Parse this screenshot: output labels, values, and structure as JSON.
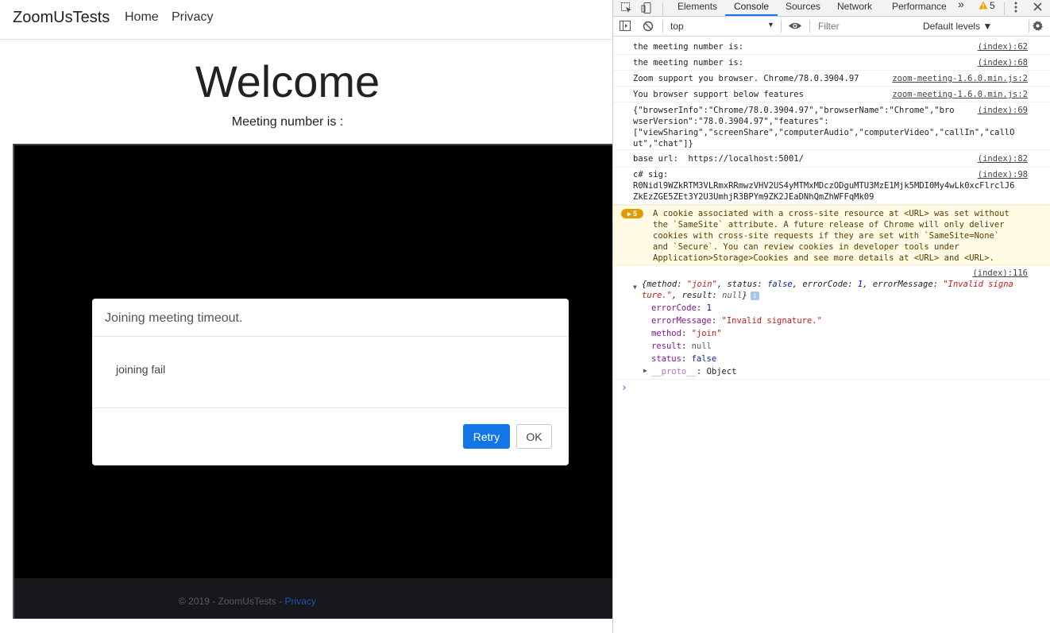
{
  "site": {
    "brand": "ZoomUsTests",
    "nav": {
      "home": "Home",
      "privacy": "Privacy"
    },
    "heading": "Welcome",
    "meeting_line": "Meeting number is :",
    "footer": {
      "text": "© 2019 - ZoomUsTests - ",
      "link": "Privacy"
    }
  },
  "dialog": {
    "title": "Joining meeting timeout.",
    "body": "joining fail",
    "retry_label": "Retry",
    "ok_label": "OK",
    "retry_color": "#1276e6"
  },
  "devtools": {
    "tabs": [
      "Elements",
      "Console",
      "Sources",
      "Network",
      "Performance"
    ],
    "more_tabs": "»",
    "warning_count": "5",
    "context": "top",
    "filter_placeholder": "Filter",
    "levels": "Default levels ▼",
    "console": {
      "rows": [
        {
          "msg": "the meeting number is:",
          "src": "(index):62"
        },
        {
          "msg": "the meeting number is:",
          "src": "(index):68"
        },
        {
          "msg": "Zoom support you browser. Chrome/78.0.3904.97",
          "src": "zoom-meeting-1.6.0.min.js:2"
        },
        {
          "msg": "You browser support below features",
          "src": "zoom-meeting-1.6.0.min.js:2"
        },
        {
          "msg": "{\"browserInfo\":\"Chrome/78.0.3904.97\",\"browserName\":\"Chrome\",\"bro\nwserVersion\":\"78.0.3904.97\",\"features\":\n[\"viewSharing\",\"screenShare\",\"computerAudio\",\"computerVideo\",\"callIn\",\"callO\nut\",\"chat\"]}",
          "src": "(index):69"
        },
        {
          "msg": "base url:  https://localhost:5001/",
          "src": "(index):82"
        },
        {
          "msg": "c# sig:\nR0Nidl9WZkRTM3VLRmxRRmwzVHV2US4yMTMxMDczODguMTU3MzE1Mjk5MDI0My4wLk0xcFlrclJ6\nZkEzZGE5ZEt3Y2U3UmhjR3BPYm9ZK2JEaDNhQmZhWFFqMk09",
          "src": "(index):98"
        }
      ],
      "warning": {
        "count": "5",
        "msg": "A cookie associated with a cross-site resource at <URL> was set without\nthe `SameSite` attribute. A future release of Chrome will only deliver\ncookies with cross-site requests if they are set with `SameSite=None`\nand `Secure`. You can review cookies in developer tools under\nApplication>Storage>Cookies and see more details at <URL> and <URL>."
      },
      "object_log": {
        "src": "(index):116",
        "summary_a": "{method: ",
        "summary_method": "\"join\"",
        "summary_b": ", status: ",
        "summary_status": "false",
        "summary_c": ", errorCode: ",
        "summary_code": "1",
        "summary_d": ", errorMessage: ",
        "summary_err1": "\"Invalid signa",
        "summary_err2": "ture.\"",
        "summary_e": ", result: ",
        "summary_result": "null",
        "summary_f": "}",
        "props": [
          {
            "key": "errorCode",
            "value": "1",
            "type": "num"
          },
          {
            "key": "errorMessage",
            "value": "\"Invalid signature.\"",
            "type": "str"
          },
          {
            "key": "method",
            "value": "\"join\"",
            "type": "str"
          },
          {
            "key": "result",
            "value": "null",
            "type": "null"
          },
          {
            "key": "status",
            "value": "false",
            "type": "kw"
          }
        ],
        "proto_key": "__proto__",
        "proto_value": "Object"
      },
      "prompt": "›"
    }
  }
}
